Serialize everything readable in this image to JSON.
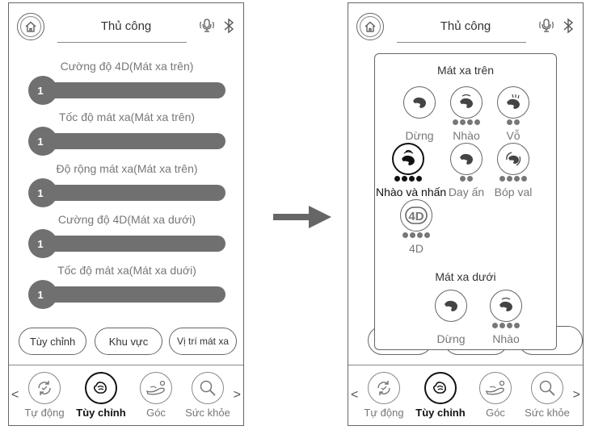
{
  "left": {
    "title": "Thủ công",
    "sliders": [
      {
        "label": "Cường độ 4D(Mát xa trên)",
        "value": "1"
      },
      {
        "label": "Tốc độ mát xa(Mát xa trên)",
        "value": "1"
      },
      {
        "label": "Độ rộng mát xa(Mát xa trên)",
        "value": "1"
      },
      {
        "label": "Cường độ 4D(Mát xa dưới)",
        "value": "1"
      },
      {
        "label": "Tốc độ mát xa(Mát xa duới)",
        "value": "1"
      }
    ],
    "pills": [
      "Tùy chỉnh",
      "Khu vực",
      "Vị trí mát xa"
    ]
  },
  "right": {
    "title": "Thủ công",
    "popup": {
      "upper_title": "Mát xa trên",
      "upper_modes": [
        {
          "label": "Dừng",
          "icon": "stop-hand-icon",
          "dots": 0
        },
        {
          "label": "Nhào",
          "icon": "knead-icon",
          "dots": 4
        },
        {
          "label": "Vỗ",
          "icon": "tap-icon",
          "dots": 2
        },
        {
          "label": "Nhào và nhấn",
          "icon": "knead-press-icon",
          "dots": 4,
          "selected": true
        },
        {
          "label": "Day ấn",
          "icon": "press-icon",
          "dots": 2
        },
        {
          "label": "Bóp val",
          "icon": "squeeze-icon",
          "dots": 4
        },
        {
          "label": "4D",
          "icon": "4d-icon",
          "dots": 4
        }
      ],
      "lower_title": "Mát xa dưới",
      "lower_modes": [
        {
          "label": "Dừng",
          "icon": "stop-hand-icon",
          "dots": 0
        },
        {
          "label": "Nhào",
          "icon": "knead-icon",
          "dots": 4
        }
      ]
    }
  },
  "nav": {
    "items": [
      {
        "label": "Tự động",
        "icon": "auto-cycle-icon"
      },
      {
        "label": "Tùy chỉnh",
        "icon": "hand-touch-icon",
        "active": true
      },
      {
        "label": "Góc",
        "icon": "recline-angle-icon"
      },
      {
        "label": "Sức khỏe",
        "icon": "health-search-icon"
      }
    ],
    "prev": "<",
    "next": ">"
  },
  "icons": {
    "home": "home-icon",
    "mic": "voice-icon",
    "bluetooth": "bluetooth-icon",
    "transition": "right-arrow-icon",
    "four_d_glyph": "4D"
  },
  "colors": {
    "slider": "#707070",
    "border": "#666666",
    "text_dark": "#111111",
    "text_muted": "#777777"
  }
}
